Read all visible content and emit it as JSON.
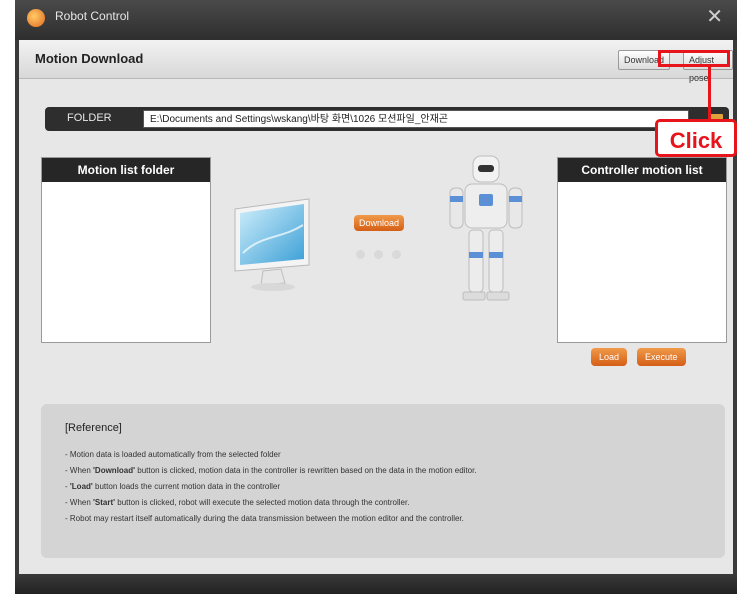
{
  "window": {
    "title": "Robot Control",
    "close_symbol": "✕"
  },
  "header": {
    "title": "Motion Download",
    "download_label": "Download",
    "adjust_label": "Adjust pose"
  },
  "folder": {
    "label": "FOLDER",
    "path": "E:\\Documents and Settings\\wskang\\바탕 화면\\1026 모션파일_안재곤"
  },
  "panels": {
    "left_title": "Motion list folder",
    "right_title": "Controller motion list"
  },
  "center": {
    "download_label": "Download"
  },
  "controller_buttons": {
    "load_label": "Load",
    "execute_label": "Execute"
  },
  "reference": {
    "title": "[Reference]",
    "lines": [
      {
        "pre": "- Motion data is loaded automatically from the selected folder",
        "bold": "",
        "post": ""
      },
      {
        "pre": "- When ",
        "bold": "'Download'",
        "post": " button is clicked, motion data in the controller is rewritten based on the data in the motion editor."
      },
      {
        "pre": "- ",
        "bold": "'Load'",
        "post": " button loads the current motion data in the controller"
      },
      {
        "pre": "- When ",
        "bold": "'Start'",
        "post": " button is clicked, robot will execute the selected motion data through the controller."
      },
      {
        "pre": "- Robot may restart itself automatically during the data transmission between the motion editor and the controller.",
        "bold": "",
        "post": ""
      }
    ]
  },
  "annotation": {
    "label": "Click",
    "color": "#e8141b"
  },
  "colors": {
    "accent_orange": "#e07a2c",
    "panel_header": "#262626"
  }
}
